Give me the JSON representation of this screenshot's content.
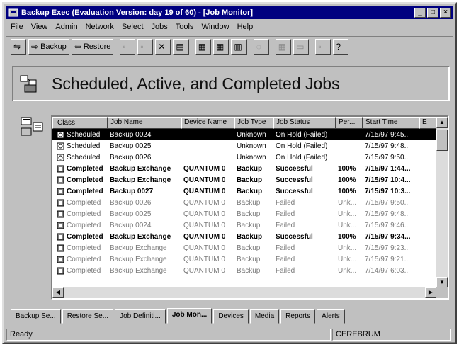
{
  "window": {
    "title": "Backup Exec (Evaluation Version: day 19 of 60) - [Job Monitor]"
  },
  "menu": [
    "File",
    "View",
    "Admin",
    "Network",
    "Select",
    "Jobs",
    "Tools",
    "Window",
    "Help"
  ],
  "toolbar": {
    "backup_label": "Backup",
    "restore_label": "Restore"
  },
  "banner": {
    "title": "Scheduled, Active, and Completed Jobs"
  },
  "columns": [
    "Class",
    "Job Name",
    "Device Name",
    "Job Type",
    "Job Status",
    "Per...",
    "Start Time",
    "E"
  ],
  "rows": [
    {
      "cls": "Scheduled",
      "name": "Backup 0024",
      "device": "",
      "type": "Unknown",
      "status": "On Hold (Failed)",
      "pct": "",
      "time": "7/15/97 9:45..."
    },
    {
      "cls": "Scheduled",
      "name": "Backup 0025",
      "device": "",
      "type": "Unknown",
      "status": "On Hold (Failed)",
      "pct": "",
      "time": "7/15/97 9:48..."
    },
    {
      "cls": "Scheduled",
      "name": "Backup 0026",
      "device": "",
      "type": "Unknown",
      "status": "On Hold (Failed)",
      "pct": "",
      "time": "7/15/97 9:50..."
    },
    {
      "cls": "Completed",
      "name": "Backup Exchange",
      "device": "QUANTUM 0",
      "type": "Backup",
      "status": "Successful",
      "pct": "100%",
      "time": "7/15/97 1:44..."
    },
    {
      "cls": "Completed",
      "name": "Backup Exchange",
      "device": "QUANTUM 0",
      "type": "Backup",
      "status": "Successful",
      "pct": "100%",
      "time": "7/15/97 10:4..."
    },
    {
      "cls": "Completed",
      "name": "Backup 0027",
      "device": "QUANTUM 0",
      "type": "Backup",
      "status": "Successful",
      "pct": "100%",
      "time": "7/15/97 10:3..."
    },
    {
      "cls": "Completed",
      "name": "Backup 0026",
      "device": "QUANTUM 0",
      "type": "Backup",
      "status": "Failed",
      "pct": "Unk...",
      "time": "7/15/97 9:50..."
    },
    {
      "cls": "Completed",
      "name": "Backup 0025",
      "device": "QUANTUM 0",
      "type": "Backup",
      "status": "Failed",
      "pct": "Unk...",
      "time": "7/15/97 9:48..."
    },
    {
      "cls": "Completed",
      "name": "Backup 0024",
      "device": "QUANTUM 0",
      "type": "Backup",
      "status": "Failed",
      "pct": "Unk...",
      "time": "7/15/97 9:46..."
    },
    {
      "cls": "Completed",
      "name": "Backup Exchange",
      "device": "QUANTUM 0",
      "type": "Backup",
      "status": "Successful",
      "pct": "100%",
      "time": "7/15/97 9:34..."
    },
    {
      "cls": "Completed",
      "name": "Backup Exchange",
      "device": "QUANTUM 0",
      "type": "Backup",
      "status": "Failed",
      "pct": "Unk...",
      "time": "7/15/97 9:23..."
    },
    {
      "cls": "Completed",
      "name": "Backup Exchange",
      "device": "QUANTUM 0",
      "type": "Backup",
      "status": "Failed",
      "pct": "Unk...",
      "time": "7/15/97 9:21..."
    },
    {
      "cls": "Completed",
      "name": "Backup Exchange",
      "device": "QUANTUM 0",
      "type": "Backup",
      "status": "Failed",
      "pct": "Unk...",
      "time": "7/14/97 6:03..."
    }
  ],
  "tabs": [
    "Backup Se...",
    "Restore Se...",
    "Job Definiti...",
    "Job Mon...",
    "Devices",
    "Media",
    "Reports",
    "Alerts"
  ],
  "status": {
    "left": "Ready",
    "right": "CEREBRUM"
  }
}
